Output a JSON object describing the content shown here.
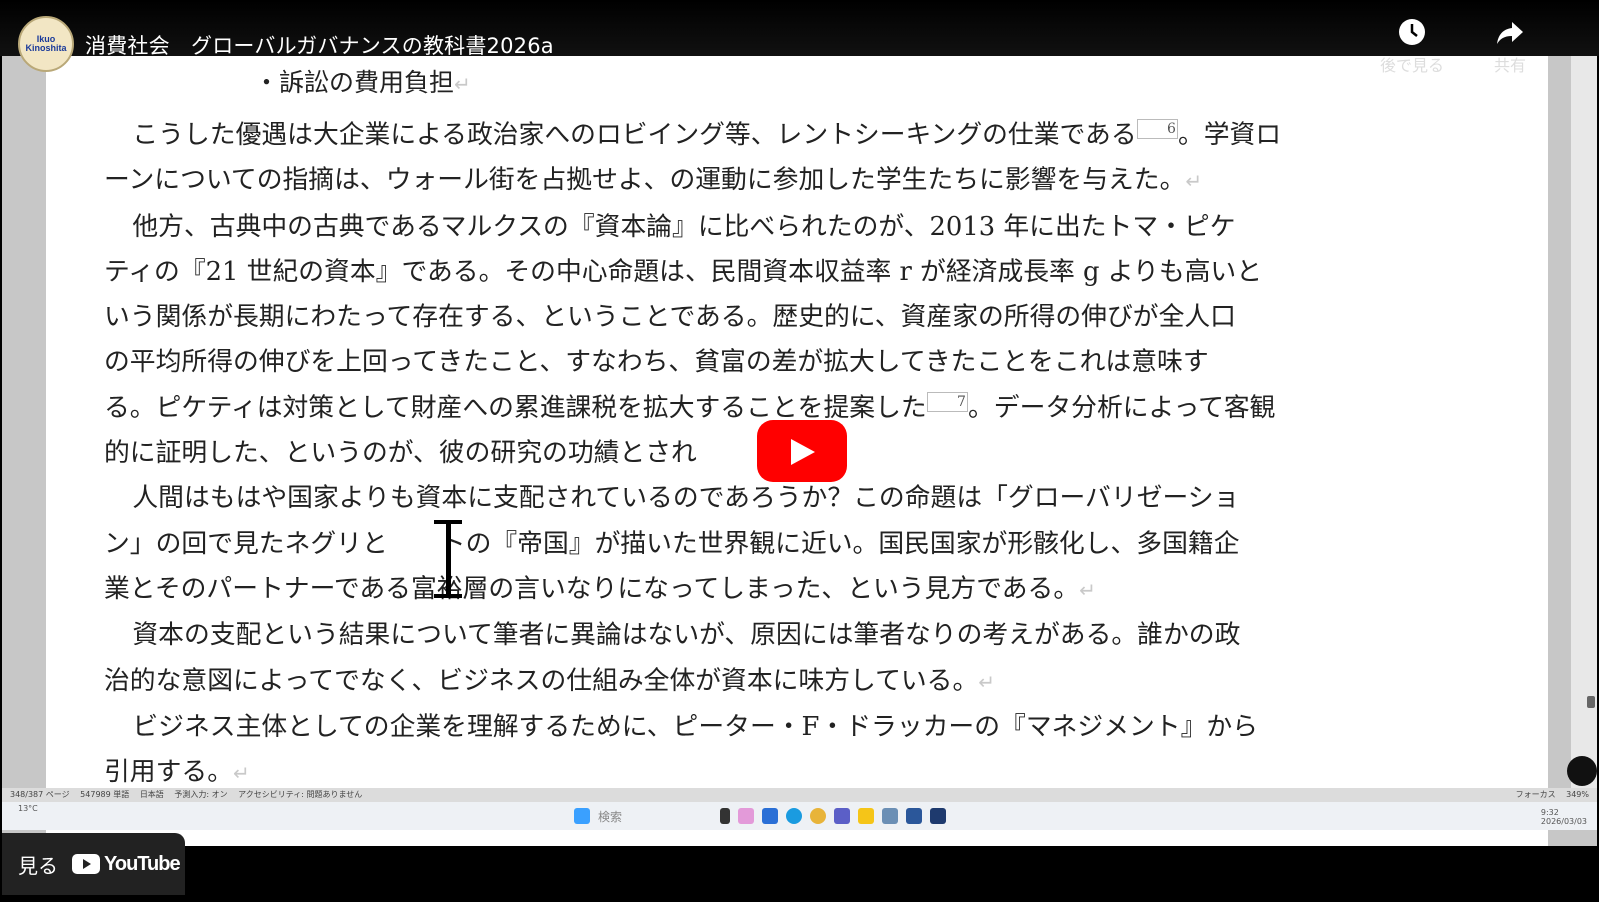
{
  "video": {
    "title": "消費社会　グローバルガバナンスの教科書2026a",
    "channel_avatar_line1": "Ikuo",
    "channel_avatar_line2": "Kinoshita",
    "watch_later_label": "後で見る",
    "share_label": "共有",
    "watch_on_label": "見る",
    "youtube_logo_text": "YouTube"
  },
  "document": {
    "heading_partial": "・訴訟の費用負担",
    "lines": [
      "こうした優遇は大企業による政治家へのロビイング等、レントシーキングの仕業である",
      "6",
      "。学資ロ",
      "ーンについての指摘は、ウォール街を占拠せよ、の運動に参加した学生たちに影響を与えた。",
      "他方、古典中の古典であるマルクスの『資本論』に比べられたのが、2013 年に出たトマ・ピケ",
      "ティの『21 世紀の資本』である。その中心命題は、民間資本収益率 r が経済成長率 g よりも高いと",
      "いう関係が長期にわたって存在する、ということである。歴史的に、資産家の所得の伸びが全人口",
      "の平均所得の伸びを上回ってきたこと、すなわち、貧富の差が拡大してきたことをこれは意味す",
      "る。ピケティは対策として財産への累進課税を拡大することを提案した",
      "7",
      "。データ分析によって客観",
      "的に証明した、というのが、彼の研究の功績とされ",
      "人間はもはや国家よりも資本に支配されているのであろうか？この命題は「グローバリゼーショ",
      "ン」の回で見たネグリと",
      "トの『帝国』が描いた世界観に近い。国民国家が形骸化し、多国籍企",
      "業とそのパートナーである",
      "富裕層の言いなりになってしまった、という見方である。",
      "資本の支配という結果",
      "について筆者に異論はないが、原因には筆者なりの考えがある。誰かの政",
      "治的な意図によってでなく、ビジネスの仕組み全体が資本に味方している。",
      "ビジネス主体としての企業を理解するために、ピーター・F・ドラッカーの『マネジメント』から",
      "引用する。"
    ],
    "paragraph_mark": "↵"
  },
  "word_status": {
    "page": "348/387 ページ",
    "words": "547989 単語",
    "language": "日本語",
    "input": "予測入力: オン",
    "accessibility": "アクセシビリティ: 問題ありません",
    "focus": "フォーカス",
    "zoom": "349%"
  },
  "taskbar": {
    "search_placeholder": "検索",
    "weather": "13°C",
    "time": "9:32",
    "date": "2026/03/03"
  },
  "colors": {
    "play_button": "#ff0000",
    "title_text": "#ffffff"
  }
}
